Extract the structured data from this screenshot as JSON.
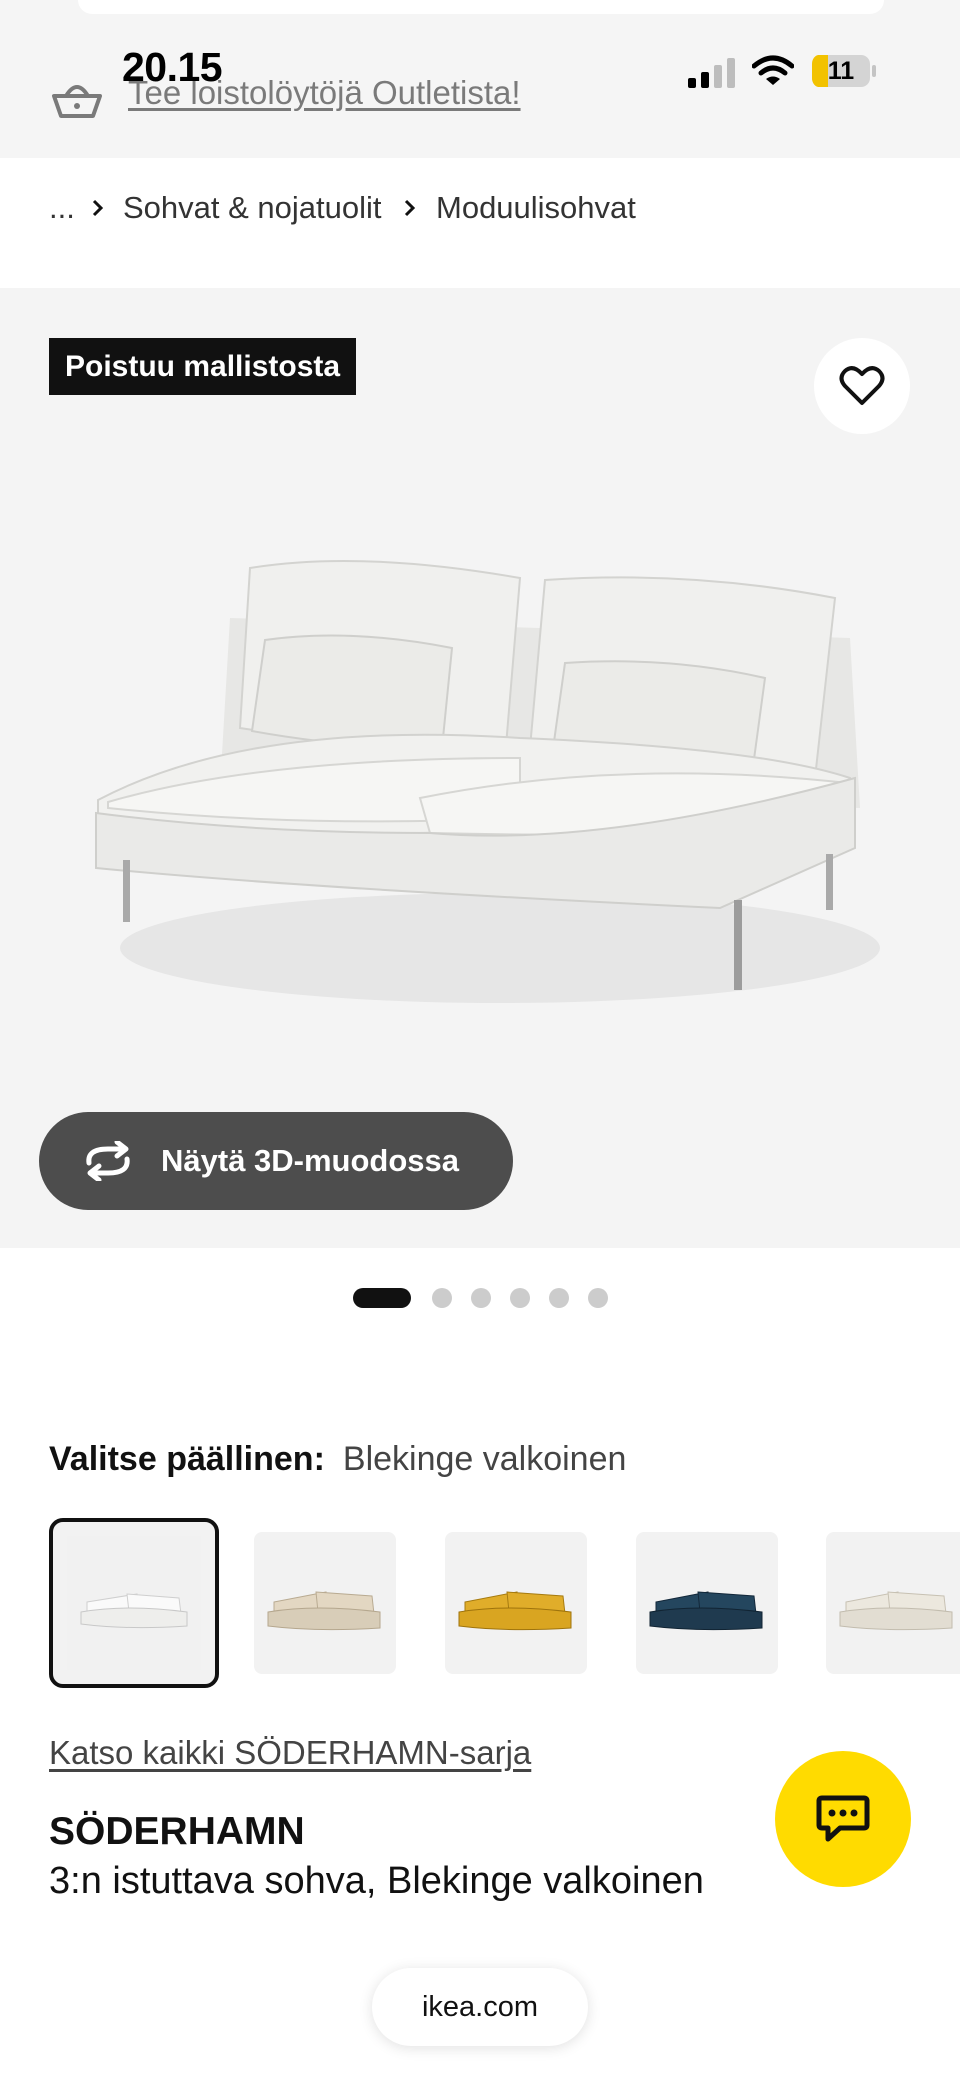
{
  "status_bar": {
    "time": "20.15",
    "battery_level": "11"
  },
  "banner": {
    "outlet_link": "Tee loistolöytöjä Outletista!"
  },
  "breadcrumb": {
    "ellipsis": "...",
    "items": [
      "Sohvat & nojatuolit",
      "Moduulisohvat"
    ]
  },
  "hero": {
    "badge": "Poistuu mallistosta",
    "view_3d_label": "Näytä 3D-muodossa",
    "image_count": 6,
    "active_image": 1
  },
  "cover": {
    "label": "Valitse päällinen:",
    "value": "Blekinge valkoinen",
    "swatches": [
      {
        "name": "blekinge-white",
        "color": "#eeeeec",
        "selected": true
      },
      {
        "name": "beige",
        "color": "#d8cdb8",
        "selected": false
      },
      {
        "name": "yellow",
        "color": "#d9a521",
        "selected": false
      },
      {
        "name": "dark-blue",
        "color": "#1f3a4f",
        "selected": false
      },
      {
        "name": "light-beige",
        "color": "#e2ddd2",
        "selected": false
      }
    ]
  },
  "product": {
    "series_link": "Katso kaikki SÖDERHAMN-sarja",
    "name": "SÖDERHAMN",
    "description": "3:n istuttava sohva, Blekinge valkoinen"
  },
  "browser": {
    "url": "ikea.com"
  },
  "colors": {
    "accent_yellow": "#ffdb00",
    "badge_black": "#111111",
    "button_grey": "#4d4d4d"
  }
}
